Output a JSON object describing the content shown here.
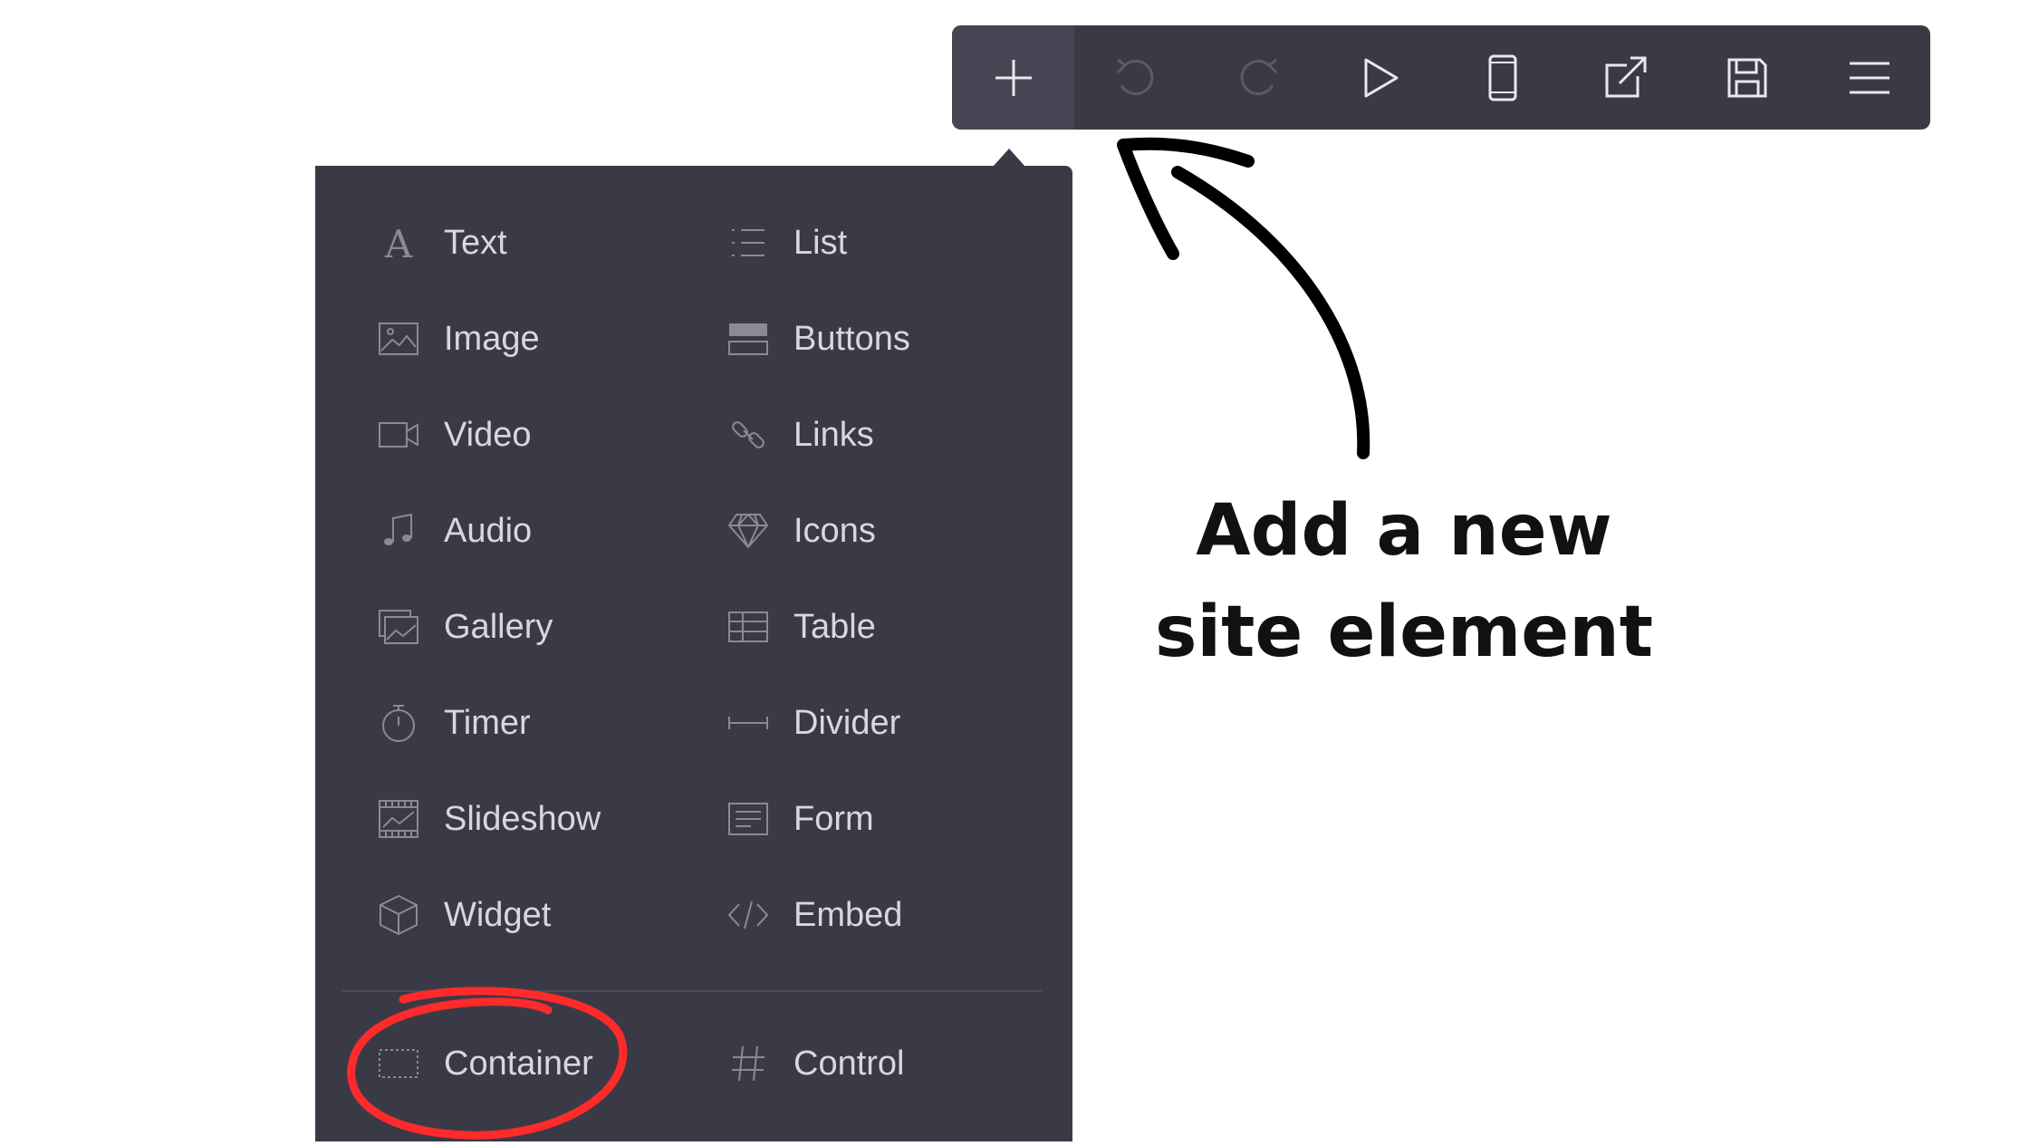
{
  "toolbar": {
    "buttons": [
      {
        "icon": "plus-icon",
        "active": true
      },
      {
        "icon": "undo-icon",
        "active": false
      },
      {
        "icon": "redo-icon",
        "active": false
      },
      {
        "icon": "play-icon",
        "active": false
      },
      {
        "icon": "mobile-icon",
        "active": false
      },
      {
        "icon": "external-link-icon",
        "active": false
      },
      {
        "icon": "save-icon",
        "active": false
      },
      {
        "icon": "menu-icon",
        "active": false
      }
    ]
  },
  "panel": {
    "left_column": [
      {
        "label": "Text",
        "icon": "text-icon"
      },
      {
        "label": "Image",
        "icon": "image-icon"
      },
      {
        "label": "Video",
        "icon": "video-icon"
      },
      {
        "label": "Audio",
        "icon": "audio-icon"
      },
      {
        "label": "Gallery",
        "icon": "gallery-icon"
      },
      {
        "label": "Timer",
        "icon": "timer-icon"
      },
      {
        "label": "Slideshow",
        "icon": "slideshow-icon"
      },
      {
        "label": "Widget",
        "icon": "widget-icon"
      }
    ],
    "right_column": [
      {
        "label": "List",
        "icon": "list-icon"
      },
      {
        "label": "Buttons",
        "icon": "buttons-icon"
      },
      {
        "label": "Links",
        "icon": "link-icon"
      },
      {
        "label": "Icons",
        "icon": "diamond-icon"
      },
      {
        "label": "Table",
        "icon": "table-icon"
      },
      {
        "label": "Divider",
        "icon": "divider-icon"
      },
      {
        "label": "Form",
        "icon": "form-icon"
      },
      {
        "label": "Embed",
        "icon": "code-icon"
      }
    ],
    "bottom": [
      {
        "label": "Container",
        "icon": "container-icon"
      },
      {
        "label": "Control",
        "icon": "hash-icon"
      }
    ]
  },
  "annotation": {
    "line1": "Add a new",
    "line2": "site element"
  },
  "colors": {
    "toolbar_bg": "#3a3a47",
    "panel_bg": "#3a3a47",
    "item_text": "#d7d7dd",
    "icon": "#8a8a96",
    "highlight_circle": "#ff2a2a",
    "arrow": "#000000"
  }
}
